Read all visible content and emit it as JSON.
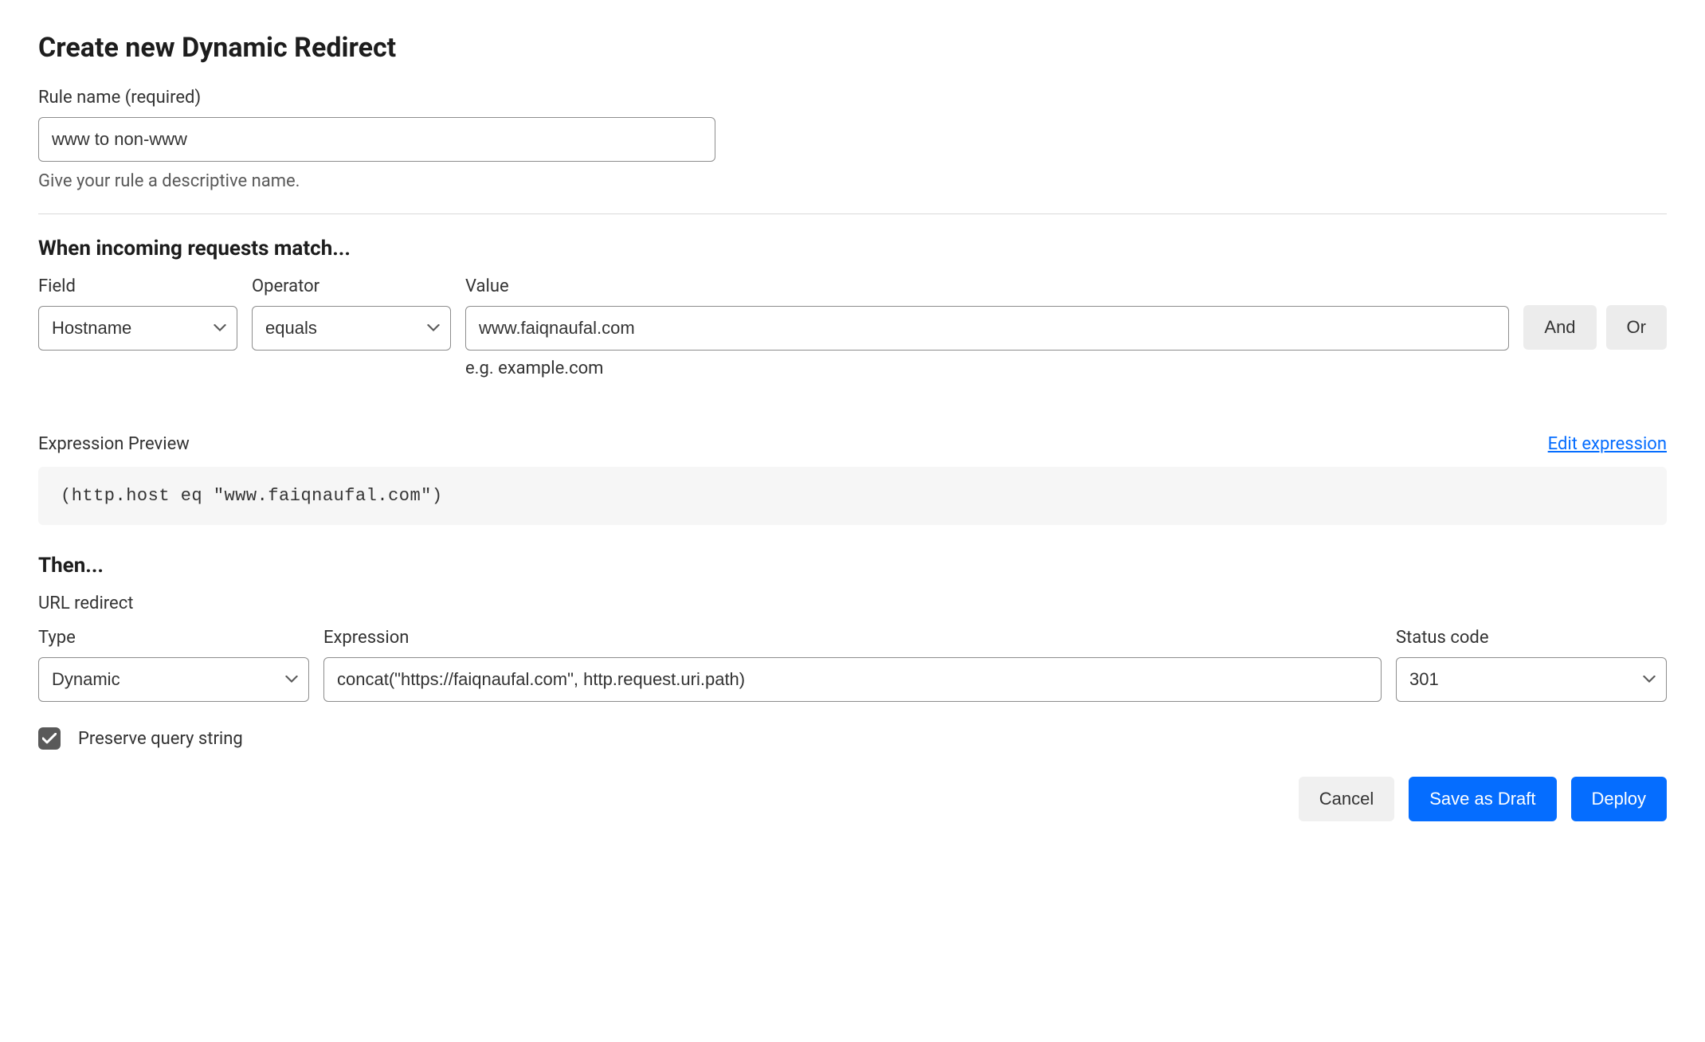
{
  "page": {
    "title": "Create new Dynamic Redirect"
  },
  "rule_name": {
    "label": "Rule name (required)",
    "value": "www to non-www",
    "helper": "Give your rule a descriptive name."
  },
  "match": {
    "heading": "When incoming requests match...",
    "field_label": "Field",
    "field_value": "Hostname",
    "operator_label": "Operator",
    "operator_value": "equals",
    "value_label": "Value",
    "value_value": "www.faiqnaufal.com",
    "value_hint": "e.g. example.com",
    "and_label": "And",
    "or_label": "Or"
  },
  "preview": {
    "label": "Expression Preview",
    "edit_link": "Edit expression",
    "expression": "(http.host eq \"www.faiqnaufal.com\")"
  },
  "then": {
    "heading": "Then...",
    "subheading": "URL redirect",
    "type_label": "Type",
    "type_value": "Dynamic",
    "expression_label": "Expression",
    "expression_value": "concat(\"https://faiqnaufal.com\", http.request.uri.path)",
    "status_label": "Status code",
    "status_value": "301"
  },
  "preserve": {
    "label": "Preserve query string",
    "checked": true
  },
  "footer": {
    "cancel": "Cancel",
    "save_draft": "Save as Draft",
    "deploy": "Deploy"
  }
}
